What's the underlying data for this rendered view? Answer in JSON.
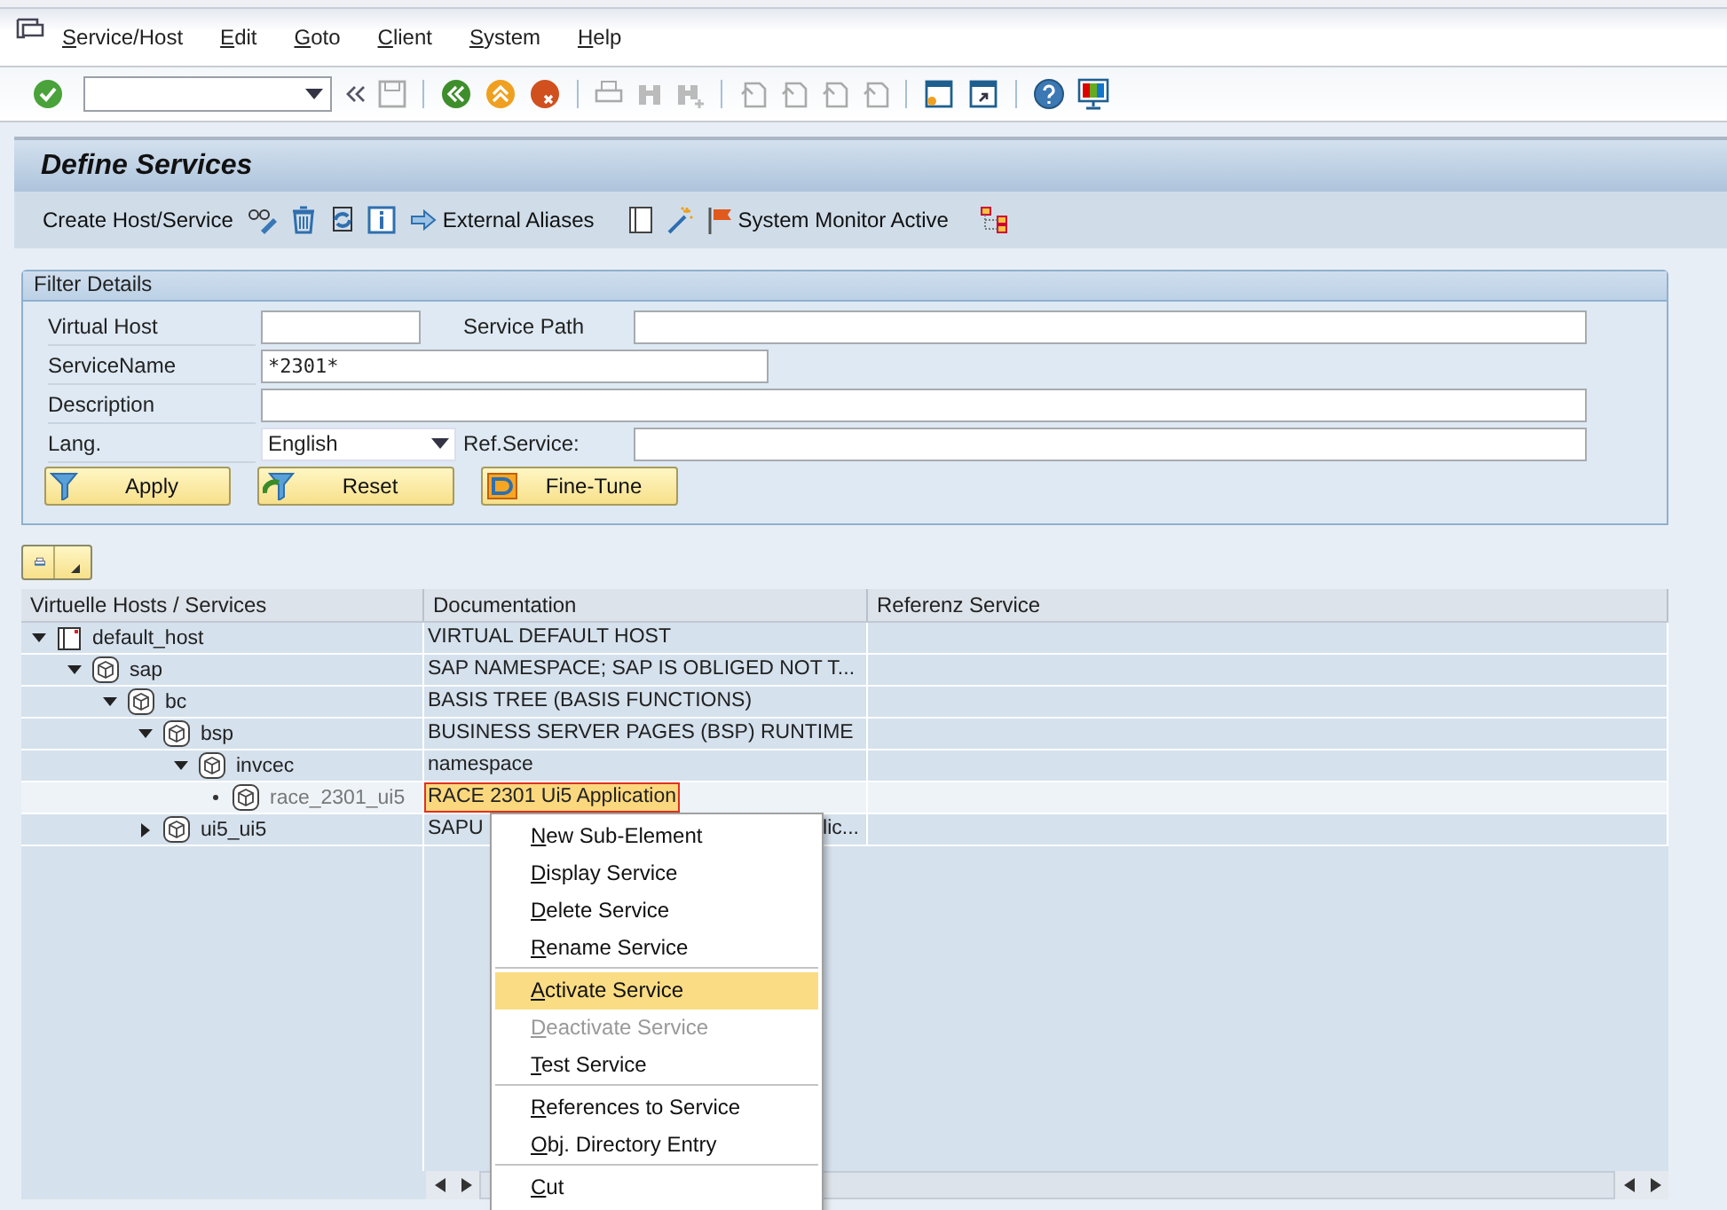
{
  "menu_bar": [
    "Service/Host",
    "Edit",
    "Goto",
    "Client",
    "System",
    "Help"
  ],
  "title": "Define Services",
  "app_toolbar": {
    "create_label": "Create Host/Service",
    "aliases_label": "External Aliases",
    "monitor_label": "System Monitor Active"
  },
  "filter": {
    "title": "Filter Details",
    "virtual_host": {
      "label": "Virtual Host"
    },
    "service_path": {
      "label": "Service Path"
    },
    "service_name": {
      "label": "ServiceName",
      "value": "*2301*"
    },
    "description": {
      "label": "Description"
    },
    "language": {
      "label": "Lang.",
      "value": "English"
    },
    "ref_service": {
      "label": "Ref.Service:"
    },
    "buttons": [
      {
        "label": "Apply",
        "kind": "filter"
      },
      {
        "label": "Reset",
        "kind": "reset"
      },
      {
        "label": "Fine-Tune",
        "kind": "tune"
      }
    ]
  },
  "tree": {
    "columns": [
      "Virtuelle Hosts / Services",
      "Documentation",
      "Referenz Service"
    ],
    "nodes": [
      {
        "name": "default_host",
        "kind": "host",
        "documentation": "VIRTUAL DEFAULT HOST",
        "expanded": true,
        "active": true,
        "selected": false,
        "children": [
          {
            "name": "sap",
            "kind": "service",
            "documentation": "SAP NAMESPACE; SAP IS OBLIGED NOT T...",
            "expanded": true,
            "active": true,
            "selected": false,
            "children": [
              {
                "name": "bc",
                "kind": "service",
                "documentation": "BASIS TREE (BASIS FUNCTIONS)",
                "expanded": true,
                "active": true,
                "selected": false,
                "children": [
                  {
                    "name": "bsp",
                    "kind": "service",
                    "documentation": "BUSINESS SERVER PAGES (BSP) RUNTIME",
                    "expanded": true,
                    "active": true,
                    "selected": false,
                    "children": [
                      {
                        "name": "invcec",
                        "kind": "service",
                        "documentation": "namespace",
                        "expanded": true,
                        "active": true,
                        "selected": false,
                        "children": [
                          {
                            "name": "race_2301_ui5",
                            "kind": "service",
                            "documentation": "RACE 2301 Ui5 Application",
                            "leaf": true,
                            "active": false,
                            "selected": true
                          }
                        ]
                      }
                    ]
                  },
                  {
                    "name": "ui5_ui5",
                    "kind": "service",
                    "documentation": "SAPU",
                    "documentation_end": "lic...",
                    "expanded": false,
                    "active": true,
                    "selected": false
                  }
                ]
              }
            ]
          }
        ]
      }
    ]
  },
  "context_menu": [
    {
      "label": "New Sub-Element",
      "disabled": false,
      "selected": false,
      "separator_after": false
    },
    {
      "label": "Display Service",
      "disabled": false,
      "selected": false,
      "separator_after": false
    },
    {
      "label": "Delete Service",
      "disabled": false,
      "selected": false,
      "separator_after": false
    },
    {
      "label": "Rename Service",
      "disabled": false,
      "selected": false,
      "separator_after": true
    },
    {
      "label": "Activate Service",
      "disabled": false,
      "selected": true,
      "separator_after": false
    },
    {
      "label": "Deactivate Service",
      "disabled": true,
      "selected": false,
      "separator_after": false
    },
    {
      "label": "Test Service",
      "disabled": false,
      "selected": false,
      "separator_after": true
    },
    {
      "label": "References to Service",
      "disabled": false,
      "selected": false,
      "separator_after": false
    },
    {
      "label": "Obj. Directory Entry",
      "disabled": false,
      "selected": false,
      "separator_after": true
    },
    {
      "label": "Cut",
      "disabled": false,
      "selected": false,
      "separator_after": false
    }
  ]
}
